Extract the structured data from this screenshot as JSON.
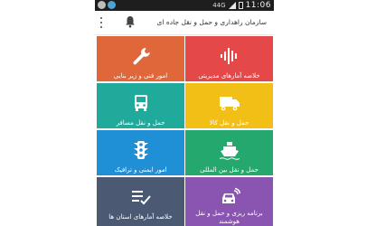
{
  "status_bar": {
    "network_label": "44G",
    "time": "11:06"
  },
  "app_bar": {
    "title": "سازمان راهداری و حمل و نقل جاده ای",
    "menu_icon": "overflow-menu-icon",
    "notification_icon": "bell-icon"
  },
  "tiles": [
    {
      "label": "امور فنی و زیر بنایی",
      "icon": "wrench-icon",
      "color": "#e0673a"
    },
    {
      "label": "خلاصه آمارهای مدیریتی",
      "icon": "sound-wave-icon",
      "color": "#e44848"
    },
    {
      "label": "حمل و نقل مسافر",
      "icon": "bus-icon",
      "color": "#1faa9c"
    },
    {
      "label": "حمل و نقل کالا",
      "icon": "truck-icon",
      "color": "#f2bf16"
    },
    {
      "label": "امور ایمنی و ترافیک",
      "icon": "traffic-light-icon",
      "color": "#1f8fd6"
    },
    {
      "label": "حمل و نقل بین المللی",
      "icon": "ship-icon",
      "color": "#25a86e"
    },
    {
      "label": "خلاصه آمارهای استان ها",
      "icon": "checklist-icon",
      "color": "#4b5a72"
    },
    {
      "label": "برنامه ریزی و حمل و نقل هوشمند",
      "icon": "smart-car-icon",
      "color": "#8a55b0"
    }
  ]
}
